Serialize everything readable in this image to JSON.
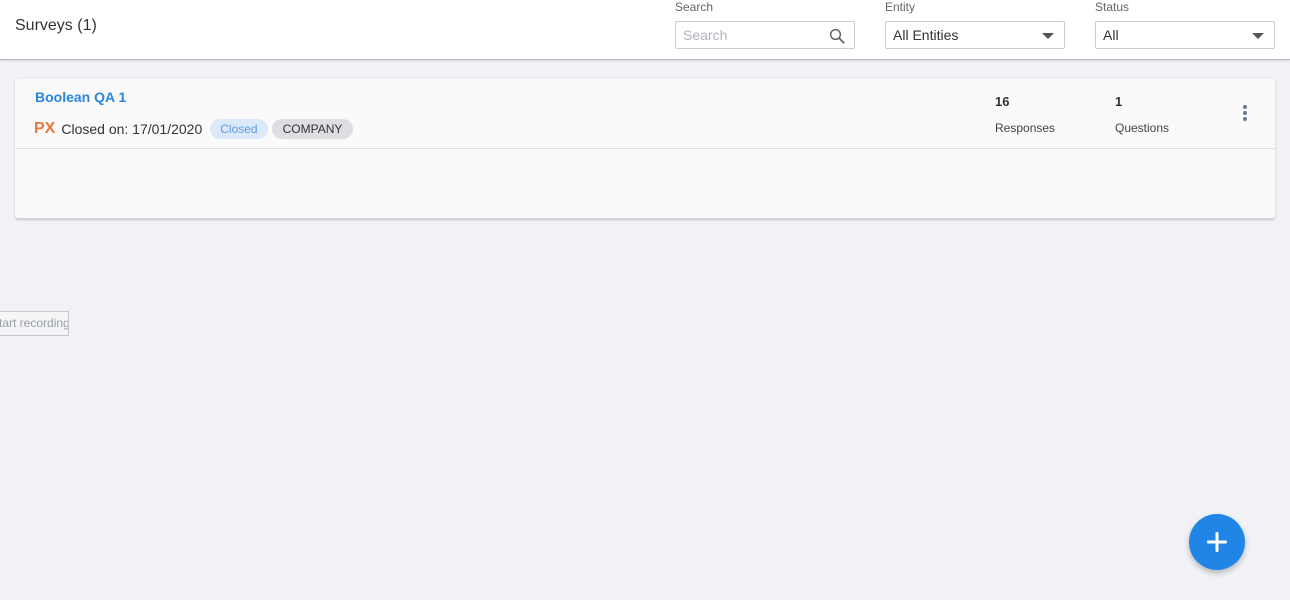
{
  "header": {
    "title": "Surveys (1)",
    "search": {
      "label": "Search",
      "placeholder": "Search",
      "value": ""
    },
    "entity": {
      "label": "Entity",
      "value": "All Entities"
    },
    "status": {
      "label": "Status",
      "value": "All"
    }
  },
  "survey": {
    "title": "Boolean QA 1",
    "logo": "PX",
    "closed_on": "Closed on: 17/01/2020",
    "status_badge": "Closed",
    "entity_badge": "COMPANY",
    "responses": {
      "value": "16",
      "label": "Responses"
    },
    "questions": {
      "value": "1",
      "label": "Questions"
    }
  },
  "tooltip": {
    "text": "Start recording"
  },
  "icons": {
    "search": "search-icon",
    "dropdown": "chevron-down-icon",
    "more": "more-vert-icon",
    "add": "plus-icon"
  },
  "colors": {
    "accent": "#2085e6",
    "link": "#2a86dd",
    "logo": "#e8793a"
  }
}
